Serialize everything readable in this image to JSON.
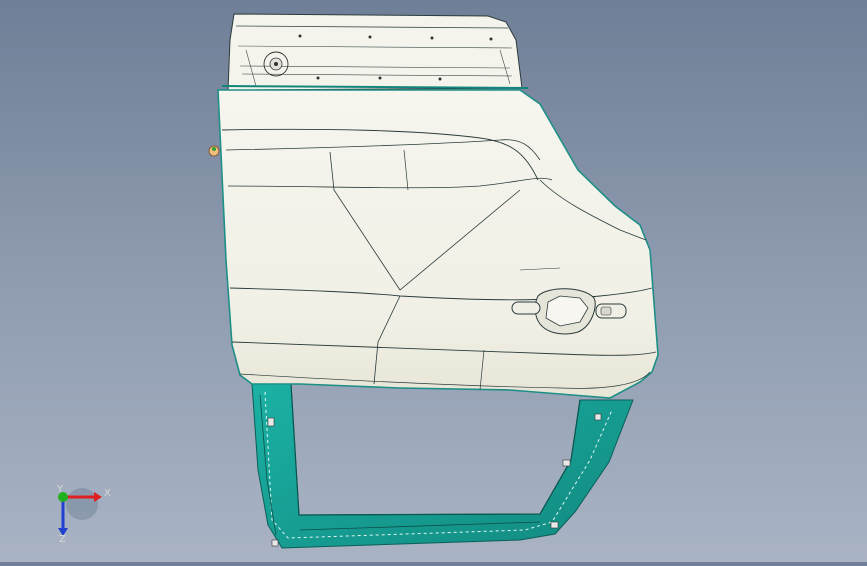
{
  "viewport": {
    "model": "car-door-assembly",
    "colors": {
      "background_top": "#6f7f97",
      "background_bottom": "#a9b3c4",
      "panel_fill": "#f3f2ea",
      "panel_shade": "#e4e3d8",
      "frame_fill": "#19a79a",
      "frame_dark": "#0c6e66",
      "edge": "#2a3a3a"
    }
  },
  "triad": {
    "x_label": "X",
    "y_label": "Y",
    "z_label": "Z",
    "colors": {
      "x": "#e02020",
      "y": "#20b020",
      "z": "#2040d0"
    }
  }
}
